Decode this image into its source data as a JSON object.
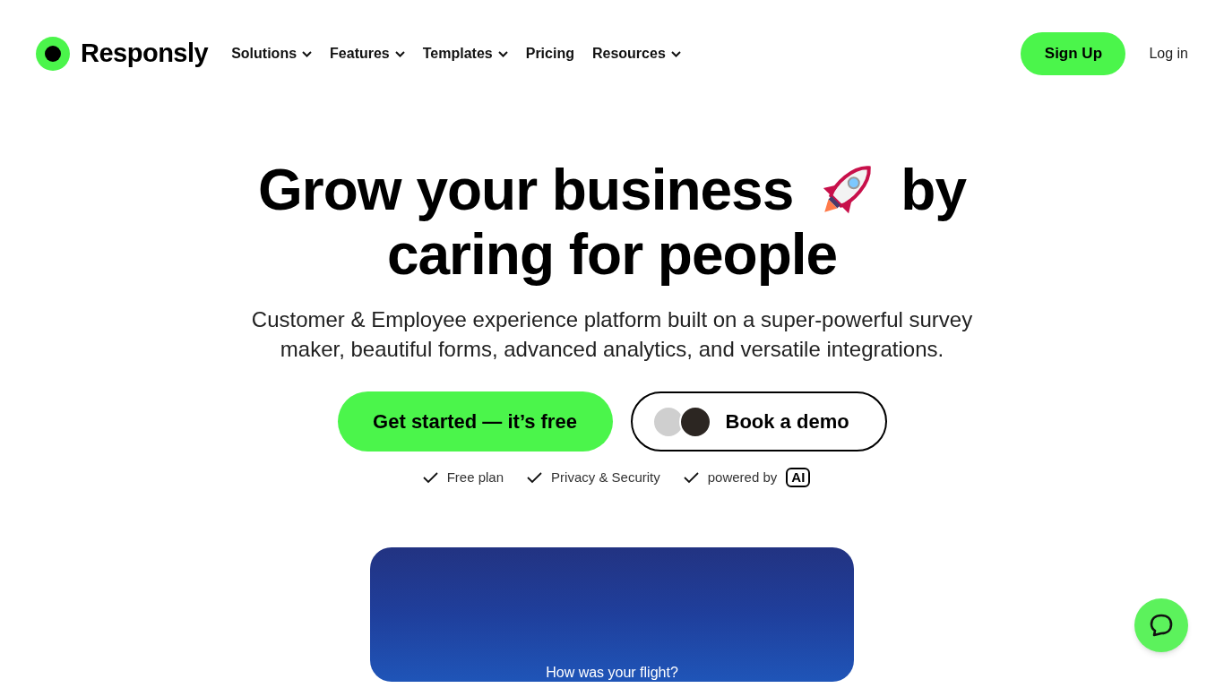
{
  "brand": {
    "name": "Responsly"
  },
  "nav": [
    {
      "label": "Solutions",
      "has_menu": true
    },
    {
      "label": "Features",
      "has_menu": true
    },
    {
      "label": "Templates",
      "has_menu": true
    },
    {
      "label": "Pricing",
      "has_menu": false
    },
    {
      "label": "Resources",
      "has_menu": true
    }
  ],
  "header_actions": {
    "signup": "Sign Up",
    "login": "Log in"
  },
  "hero": {
    "headline_start": "Grow your business",
    "headline_end": "by",
    "headline_second_line": "caring for people",
    "subtitle": "Customer & Employee experience platform built on a super-powerful survey maker, beautiful forms, advanced analytics, and versatile integrations.",
    "primary_button": "Get started — it’s free",
    "demo_button": "Book a demo",
    "features": [
      {
        "label": "Free plan"
      },
      {
        "label": "Privacy & Security"
      },
      {
        "label": "powered by",
        "badge": "AI"
      }
    ]
  },
  "preview": {
    "question": "How was your flight?"
  }
}
